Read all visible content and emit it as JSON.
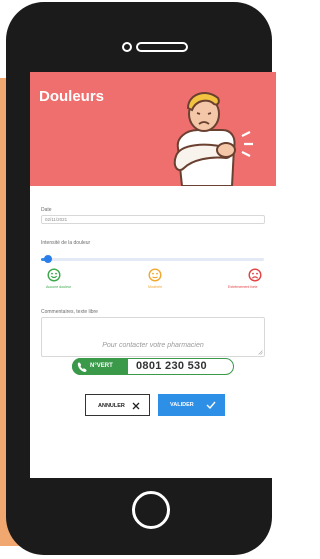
{
  "header": {
    "title": "Douleurs"
  },
  "form": {
    "date_label": "Date",
    "date_value": "02/11/2021",
    "intensity_label": "Intensité de la douleur",
    "intensity_level": 0.03,
    "scale": [
      {
        "label": "Aucune douleur",
        "color": "#3aa84a"
      },
      {
        "label": "Modérée",
        "color": "#f0a830"
      },
      {
        "label": "Extrêmement forte",
        "color": "#e14141"
      }
    ],
    "comments_label": "Commentaires, texte libre",
    "comments_value": ""
  },
  "actions": {
    "cancel_label": "ANNULER",
    "validate_label": "VALIDER"
  },
  "contact": {
    "text": "Pour contacter votre pharmacien",
    "badge_label": "N°VERT",
    "phone": "0801 230 530",
    "badge_color": "#3a9a4a"
  },
  "colors": {
    "header": "#ef6f6f",
    "accent": "#2e8fe6",
    "side": "#f0a870"
  }
}
